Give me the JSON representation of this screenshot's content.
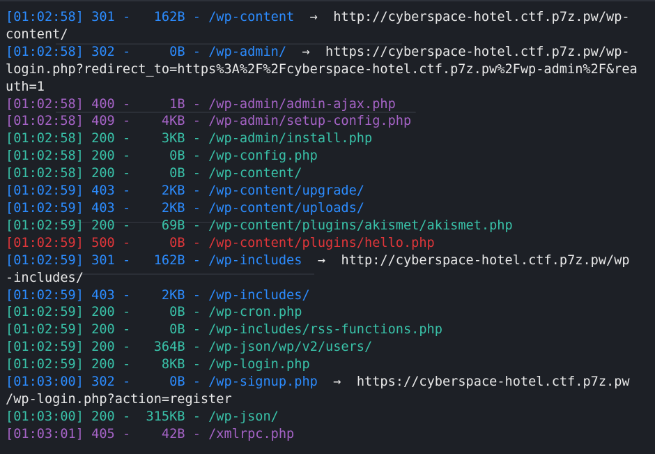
{
  "colors": {
    "s200": "#39c2a9",
    "s301": "#2c8cff",
    "s302": "#2c8cff",
    "s400": "#a563c6",
    "s403": "#2c8cff",
    "s405": "#a563c6",
    "s409": "#a563c6",
    "s500": "#e0363a",
    "redirect_text": "#e8e8e8",
    "background": "#1d2026"
  },
  "arrow_glyph": "→",
  "terminal": {
    "lines": [
      {
        "time": "[01:02:58]",
        "status": "301",
        "size": "162B",
        "path": "/wp-content",
        "redirect": "http://cyberspace-hotel.ctf.p7z.pw/wp-",
        "cont": "content/"
      },
      {
        "time": "[01:02:58]",
        "status": "302",
        "size": "0B",
        "path": "/wp-admin/",
        "redirect": "https://cyberspace-hotel.ctf.p7z.pw/wp-",
        "cont": "login.php?redirect_to=https%3A%2F%2Fcyberspace-hotel.ctf.p7z.pw%2Fwp-admin%2F&rea",
        "cont2": "uth=1"
      },
      {
        "time": "[01:02:58]",
        "status": "400",
        "size": "1B",
        "path": "/wp-admin/admin-ajax.php"
      },
      {
        "time": "[01:02:58]",
        "status": "409",
        "size": "4KB",
        "path": "/wp-admin/setup-config.php"
      },
      {
        "time": "[01:02:58]",
        "status": "200",
        "size": "3KB",
        "path": "/wp-admin/install.php"
      },
      {
        "time": "[01:02:58]",
        "status": "200",
        "size": "0B",
        "path": "/wp-config.php"
      },
      {
        "time": "[01:02:58]",
        "status": "200",
        "size": "0B",
        "path": "/wp-content/"
      },
      {
        "time": "[01:02:59]",
        "status": "403",
        "size": "2KB",
        "path": "/wp-content/upgrade/"
      },
      {
        "time": "[01:02:59]",
        "status": "403",
        "size": "2KB",
        "path": "/wp-content/uploads/"
      },
      {
        "time": "[01:02:59]",
        "status": "200",
        "size": "69B",
        "path": "/wp-content/plugins/akismet/akismet.php"
      },
      {
        "time": "[01:02:59]",
        "status": "500",
        "size": "0B",
        "path": "/wp-content/plugins/hello.php"
      },
      {
        "time": "[01:02:59]",
        "status": "301",
        "size": "162B",
        "path": "/wp-includes",
        "redirect": "http://cyberspace-hotel.ctf.p7z.pw/wp",
        "cont": "-includes/"
      },
      {
        "time": "[01:02:59]",
        "status": "403",
        "size": "2KB",
        "path": "/wp-includes/"
      },
      {
        "time": "[01:02:59]",
        "status": "200",
        "size": "0B",
        "path": "/wp-cron.php"
      },
      {
        "time": "[01:02:59]",
        "status": "200",
        "size": "0B",
        "path": "/wp-includes/rss-functions.php"
      },
      {
        "time": "[01:02:59]",
        "status": "200",
        "size": "364B",
        "path": "/wp-json/wp/v2/users/"
      },
      {
        "time": "[01:02:59]",
        "status": "200",
        "size": "8KB",
        "path": "/wp-login.php"
      },
      {
        "time": "[01:03:00]",
        "status": "302",
        "size": "0B",
        "path": "/wp-signup.php",
        "redirect": "https://cyberspace-hotel.ctf.p7z.pw",
        "cont": "/wp-login.php?action=register"
      },
      {
        "time": "[01:03:00]",
        "status": "200",
        "size": "315KB",
        "path": "/wp-json/"
      },
      {
        "time": "[01:03:01]",
        "status": "405",
        "size": "42B",
        "path": "/xmlrpc.php"
      }
    ]
  }
}
